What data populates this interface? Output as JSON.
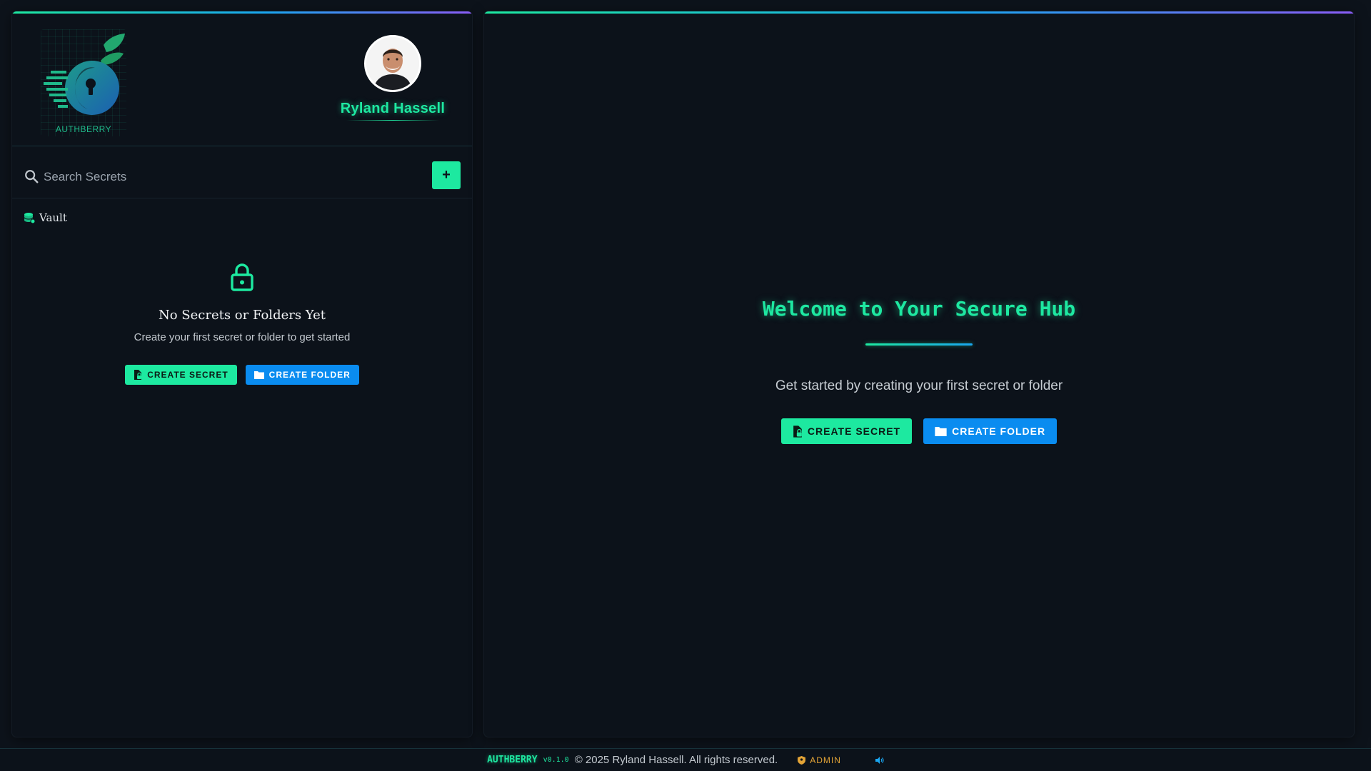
{
  "brand": {
    "logo_text": "AUTHBERRY",
    "accent": "#1de9a0",
    "secondary": "#0a8cf0"
  },
  "user": {
    "name": "Ryland Hassell"
  },
  "sidebar": {
    "search_placeholder": "Search Secrets",
    "add_label": "+",
    "tree": [
      {
        "label": "Vault",
        "icon": "database-icon"
      }
    ],
    "empty_state": {
      "icon": "lock-icon",
      "title": "No Secrets or Folders Yet",
      "subtitle": "Create your first secret or folder to get started",
      "create_secret_label": "CREATE SECRET",
      "create_folder_label": "CREATE FOLDER"
    }
  },
  "main": {
    "welcome_title": "Welcome to Your Secure Hub",
    "welcome_subtitle": "Get started by creating your first secret or folder",
    "create_secret_label": "CREATE SECRET",
    "create_folder_label": "CREATE FOLDER"
  },
  "footer": {
    "brand": "AUTHBERRY",
    "version": "v0.1.0",
    "copyright": "© 2025 Ryland Hassell. All rights reserved.",
    "admin_label": "ADMIN",
    "admin_color": "#e2a336"
  }
}
